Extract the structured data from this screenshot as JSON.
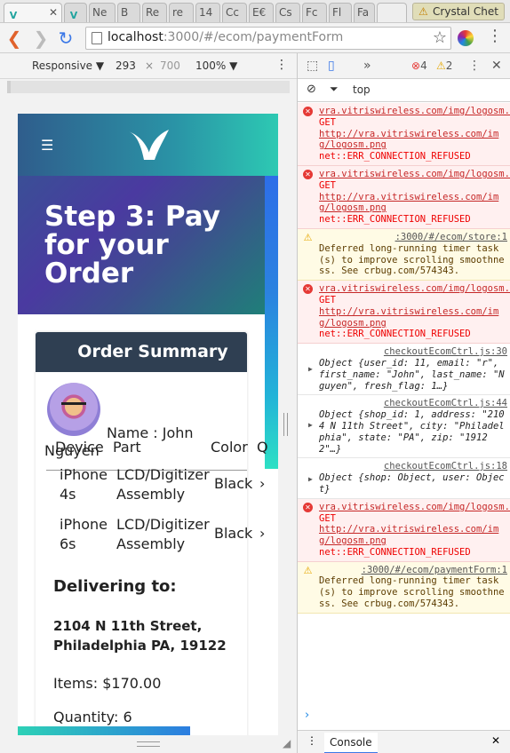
{
  "browser": {
    "tabs": [
      {
        "label": "",
        "icon": "v-logo-icon",
        "active": true
      },
      {
        "label": "",
        "icon": "close-icon",
        "active": false
      },
      {
        "label": "",
        "icon": "v-logo-icon",
        "active": false
      },
      {
        "label": "Ne",
        "icon": "",
        "active": false
      },
      {
        "label": "B",
        "icon": "",
        "active": false
      },
      {
        "label": "Re",
        "icon": "",
        "active": false
      },
      {
        "label": "re",
        "icon": "",
        "active": false
      },
      {
        "label": "14",
        "icon": "",
        "active": false
      },
      {
        "label": "Cc",
        "icon": "",
        "active": false
      },
      {
        "label": "E€",
        "icon": "",
        "active": false
      },
      {
        "label": "Cs",
        "icon": "",
        "active": false
      },
      {
        "label": "Fc",
        "icon": "",
        "active": false
      },
      {
        "label": "Fl",
        "icon": "",
        "active": false
      },
      {
        "label": "Fa",
        "icon": "",
        "active": false
      }
    ],
    "profile_name": "Crystal Chet",
    "url_host": "localhost",
    "url_path": ":3000/#/ecom/paymentForm"
  },
  "device_toolbar": {
    "mode": "Responsive",
    "width": "293",
    "height": "700",
    "zoom": "100%"
  },
  "page": {
    "hero_title": "Step 3: Pay for your Order",
    "card_title": "Order Summary",
    "name_label": "Name : John",
    "name_last": "Nguyen",
    "table_headers": [
      "Device",
      "Part",
      "Color",
      "Q"
    ],
    "rows": [
      {
        "device": "iPhone 4s",
        "part": "LCD/Digitizer Assembly",
        "color": "Black",
        "more": "›"
      },
      {
        "device": "iPhone 6s",
        "part": "LCD/Digitizer Assembly",
        "color": "Black",
        "more": "›"
      }
    ],
    "delivering_label": "Delivering to:",
    "address_line1": "2104 N 11th Street,",
    "address_line2": "Philadelphia PA, 19122",
    "items_label": "Items: $170.00",
    "quantity_label": "Quantity: 6"
  },
  "devtools": {
    "error_count": "4",
    "warning_count": "2",
    "context": "top",
    "drawer_tab": "Console",
    "messages": [
      {
        "level": "error",
        "source": "vra.vitriswireless.com/img/logosm.png:1",
        "lines": [
          "GET",
          "http://vra.vitriswireless.com/img/logosm.png",
          "net::ERR_CONNECTION_REFUSED"
        ]
      },
      {
        "level": "error",
        "source": "vra.vitriswireless.com/img/logosm.png:1",
        "lines": [
          "GET",
          "http://vra.vitriswireless.com/img/logosm.png",
          "net::ERR_CONNECTION_REFUSED"
        ]
      },
      {
        "level": "warn",
        "source": ":3000/#/ecom/store:1",
        "lines": [
          "Deferred long-running timer task(s) to improve scrolling smoothness. See crbug.com/574343."
        ]
      },
      {
        "level": "error",
        "source": "vra.vitriswireless.com/img/logosm.png:1",
        "lines": [
          "GET",
          "http://vra.vitriswireless.com/img/logosm.png",
          "net::ERR_CONNECTION_REFUSED"
        ]
      },
      {
        "level": "log",
        "source": "checkoutEcomCtrl.js:30",
        "lines": [
          "Object {user_id: 11, email: \"r\", first_name: \"John\", last_name: \"Nguyen\", fresh_flag: 1…}"
        ]
      },
      {
        "level": "log",
        "source": "checkoutEcomCtrl.js:44",
        "lines": [
          "Object {shop_id: 1, address: \"2104 N 11th Street\", city: \"Philadelphia\", state: \"PA\", zip: \"19122\"…}"
        ]
      },
      {
        "level": "log",
        "source": "checkoutEcomCtrl.js:18",
        "lines": [
          "Object {shop: Object, user: Object}"
        ]
      },
      {
        "level": "error",
        "source": "vra.vitriswireless.com/img/logosm.png:1",
        "lines": [
          "GET",
          "http://vra.vitriswireless.com/img/logosm.png",
          "net::ERR_CONNECTION_REFUSED"
        ]
      },
      {
        "level": "warn",
        "source": ":3000/#/ecom/paymentForm:1",
        "lines": [
          "Deferred long-running timer task(s) to improve scrolling smoothness. See crbug.com/574343."
        ]
      }
    ]
  }
}
